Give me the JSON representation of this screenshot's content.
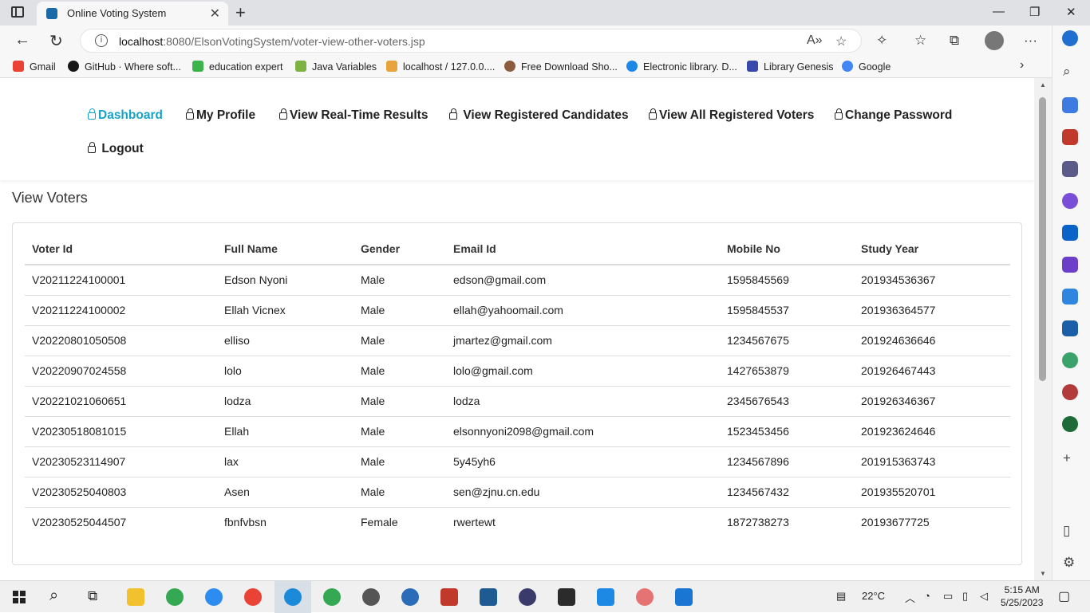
{
  "browser": {
    "tab_title": "Online Voting System",
    "url_host": "localhost",
    "url_rest": ":8080/ElsonVotingSystem/voter-view-other-voters.jsp",
    "bookmarks": [
      {
        "label": "Gmail",
        "color": "#ea4335",
        "icon": "gmail-icon"
      },
      {
        "label": "GitHub · Where soft...",
        "color": "#181717",
        "icon": "github-icon"
      },
      {
        "label": "education expert",
        "color": "#3cb44b",
        "icon": "education-expert-icon"
      },
      {
        "label": "Java Variables",
        "color": "#7cb342",
        "icon": "w3-icon"
      },
      {
        "label": "localhost / 127.0.0....",
        "color": "#e8a33d",
        "icon": "phpmyadmin-icon"
      },
      {
        "label": "Free Download Sho...",
        "color": "#8d5b3e",
        "icon": "download-icon"
      },
      {
        "label": "Electronic library. D...",
        "color": "#1e88e5",
        "icon": "library-icon"
      },
      {
        "label": "Library Genesis",
        "color": "#3949ab",
        "icon": "libgen-icon"
      },
      {
        "label": "Google",
        "color": "#4285f4",
        "icon": "google-icon"
      }
    ]
  },
  "nav": {
    "dashboard": "Dashboard",
    "my_profile": "My Profile",
    "real_time_results": "View Real-Time Results",
    "registered_candidates": "View Registered Candidates",
    "registered_voters": "View All Registered Voters",
    "change_password": "Change Password",
    "logout": "Logout"
  },
  "page": {
    "heading": "View Voters"
  },
  "table": {
    "headers": [
      "Voter Id",
      "Full Name",
      "Gender",
      "Email Id",
      "Mobile No",
      "Study Year"
    ],
    "rows": [
      [
        "V20211224100001",
        "Edson Nyoni",
        "Male",
        "edson@gmail.com",
        "1595845569",
        "201934536367"
      ],
      [
        "V20211224100002",
        "Ellah Vicnex",
        "Male",
        "ellah@yahoomail.com",
        "1595845537",
        "201936364577"
      ],
      [
        "V20220801050508",
        "elliso",
        "Male",
        "jmartez@gmail.com",
        "1234567675",
        "201924636646"
      ],
      [
        "V20220907024558",
        "lolo",
        "Male",
        "lolo@gmail.com",
        "1427653879",
        "201926467443"
      ],
      [
        "V20221021060651",
        "lodza",
        "Male",
        "lodza",
        "2345676543",
        "201926346367"
      ],
      [
        "V20230518081015",
        "Ellah",
        "Male",
        "elsonnyoni2098@gmail.com",
        "1523453456",
        "201923624646"
      ],
      [
        "V20230523114907",
        "lax",
        "Male",
        "5y45yh6",
        "1234567896",
        "201915363743"
      ],
      [
        "V20230525040803",
        "Asen",
        "Male",
        "sen@zjnu.cn.edu",
        "1234567432",
        "201935520701"
      ],
      [
        "V20230525044507",
        "fbnfvbsn",
        "Female",
        "rwertewt",
        "1872738273",
        "20193677725"
      ]
    ]
  },
  "taskbar": {
    "temperature": "22°C",
    "time": "5:15 AM",
    "date": "5/25/2023"
  },
  "colors": {
    "accent": "#17a2c8"
  }
}
